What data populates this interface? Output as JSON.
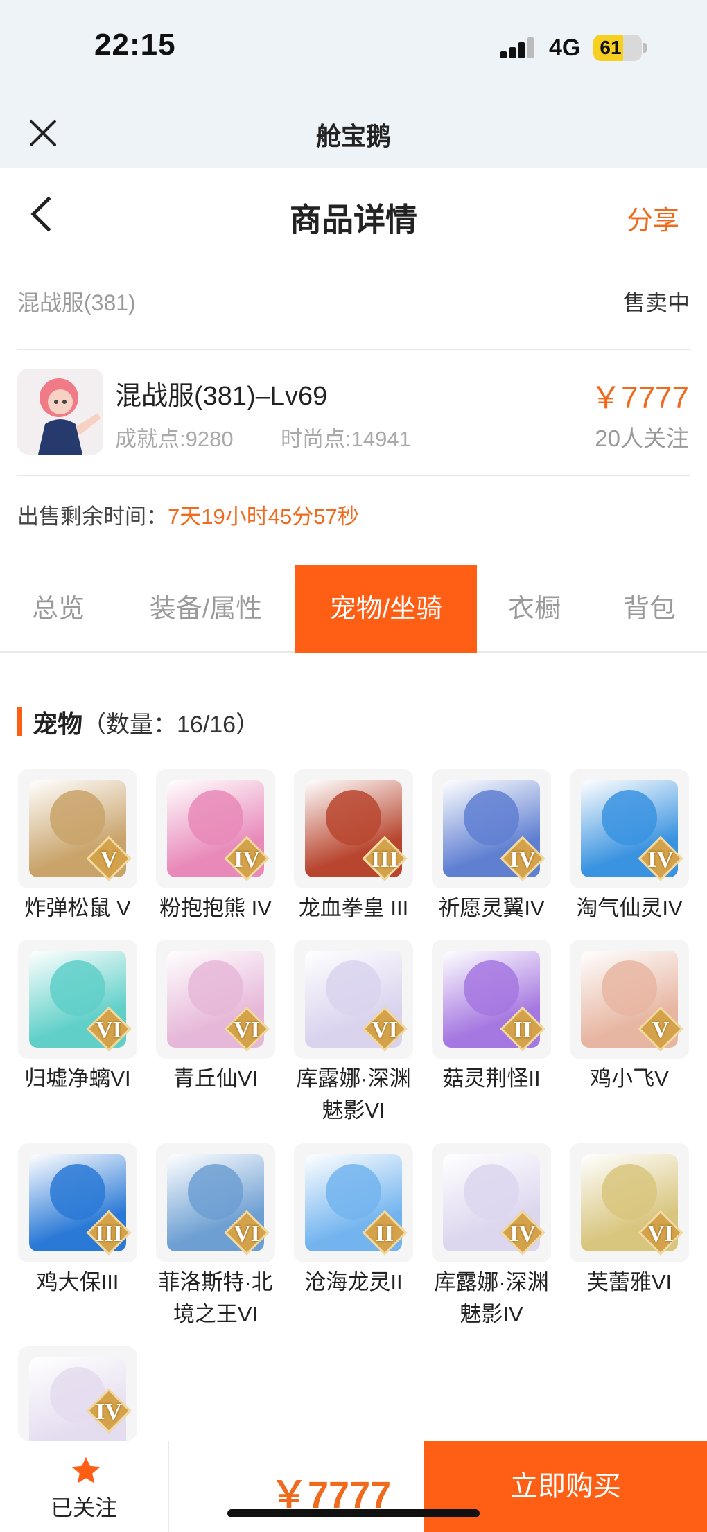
{
  "status_bar": {
    "time": "22:15",
    "network": "4G",
    "battery": "61",
    "battery_level": 0.61
  },
  "mini_program": {
    "title": "舱宝鹅"
  },
  "nav": {
    "title": "商品详情",
    "share": "分享"
  },
  "listing": {
    "server": "混战服(381)",
    "status": "售卖中",
    "title": "混战服(381)–Lv69",
    "achievement": "成就点:9280",
    "fashion": "时尚点:14941",
    "price": "￥7777",
    "followers": "20人关注",
    "time_label": "出售剩余时间：",
    "time_value": "7天19小时45分57秒"
  },
  "tabs": [
    "总览",
    "装备/属性",
    "宠物/坐骑",
    "衣橱",
    "背包"
  ],
  "active_tab": 2,
  "pets_section": {
    "title": "宠物",
    "count": "（数量：16/16）"
  },
  "pets": [
    {
      "name": "炸弹松鼠 V",
      "grade": "V",
      "color": "#c9a36a"
    },
    {
      "name": "粉抱抱熊 IV",
      "grade": "IV",
      "color": "#e889b9"
    },
    {
      "name": "龙血拳皇 III",
      "grade": "III",
      "color": "#b8462f"
    },
    {
      "name": "祈愿灵翼IV",
      "grade": "IV",
      "color": "#5f7fd1"
    },
    {
      "name": "淘气仙灵IV",
      "grade": "IV",
      "color": "#3a93e0"
    },
    {
      "name": "归墟净螭VI",
      "grade": "VI",
      "color": "#5fcfc8"
    },
    {
      "name": "青丘仙VI",
      "grade": "VI",
      "color": "#e6b7d8"
    },
    {
      "name": "库露娜·深渊魅影VI",
      "grade": "VI",
      "color": "#d9d3ee"
    },
    {
      "name": "菇灵荆怪II",
      "grade": "II",
      "color": "#a577e0"
    },
    {
      "name": "鸡小飞V",
      "grade": "V",
      "color": "#e7b6a2"
    },
    {
      "name": "鸡大保III",
      "grade": "III",
      "color": "#2a79d6"
    },
    {
      "name": "菲洛斯特·北境之王VI",
      "grade": "VI",
      "color": "#6d9fd2"
    },
    {
      "name": "沧海龙灵II",
      "grade": "II",
      "color": "#73b4ef"
    },
    {
      "name": "库露娜·深渊魅影IV",
      "grade": "IV",
      "color": "#dcd6ee"
    },
    {
      "name": "芙蕾雅VI",
      "grade": "VI",
      "color": "#d8c57e"
    },
    {
      "name": "",
      "grade": "IV",
      "color": "#e4dcef"
    }
  ],
  "bottom": {
    "follow": "已关注",
    "price": "￥7777",
    "buy": "立即购买"
  },
  "colors": {
    "accent": "#ff5f14",
    "price": "#f06a1d"
  }
}
